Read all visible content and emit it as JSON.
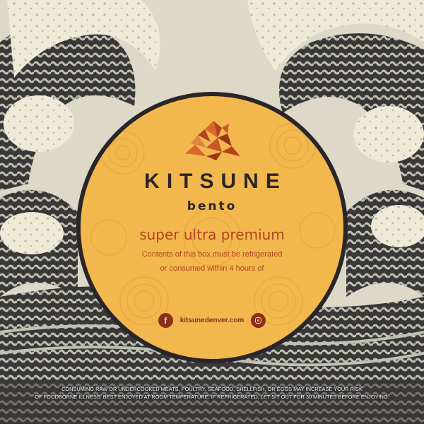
{
  "brand": {
    "name": "KITSUNE",
    "subtitle": "bento"
  },
  "tagline": "super ultra premium",
  "notice": {
    "line1": "Contents of this box must be refrigerated",
    "line2": "or consumed within 4 hours of"
  },
  "social": {
    "facebook_glyph": "f",
    "website": "kitsunedenver.com",
    "icons": [
      "facebook-icon",
      "instagram-icon"
    ]
  },
  "disclaimer": {
    "line1": "CONSUMING RAW OR UNDERCOOKED MEATS, POULTRY, SEAFOOD, SHELLFISH, OR EGGS MAY INCREASE YOUR RISK",
    "line2": "OF FOODBORNE ILLNESS. BEST ENJOYED AT ROOM TEMPERATURE. IF REFRIGERATED, LET SIT OUT FOR 30 MINUTES BEFORE ENJOYING."
  },
  "colors": {
    "circle": "#f2b84e",
    "brand_text": "#2b2526",
    "accent": "#b3421f",
    "icon_bg": "#8c2f1b",
    "wave_dark": "#3b3637",
    "wave_light": "#bcc3b3",
    "foam": "#efe9d8"
  }
}
